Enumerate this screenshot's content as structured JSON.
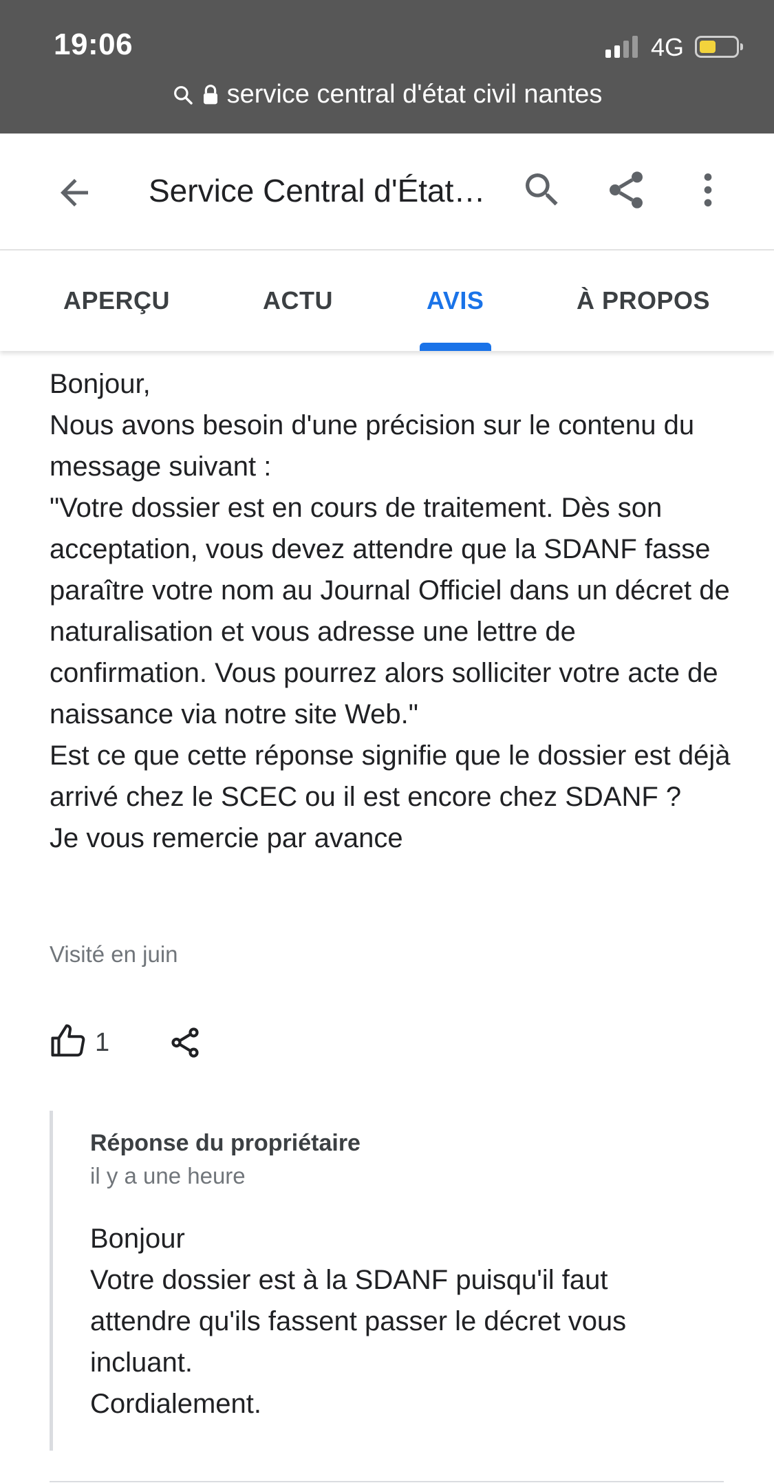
{
  "status_bar": {
    "time": "19:06",
    "network": "4G",
    "battery_level": 0.45,
    "url": "service central d'état civil nantes"
  },
  "app_bar": {
    "title": "Service Central d'État civil"
  },
  "tabs": {
    "items": [
      {
        "label": "APERÇU"
      },
      {
        "label": "ACTU"
      },
      {
        "label": "AVIS"
      },
      {
        "label": "À PROPOS"
      }
    ],
    "active": "AVIS"
  },
  "review": {
    "lines": [
      "Bonjour,",
      "Nous avons besoin d'une précision sur le contenu du message suivant :",
      "\"Votre dossier est en cours de traitement. Dès son acceptation, vous devez attendre que la SDANF fasse paraître votre nom au Journal Officiel dans un décret de naturalisation et vous adresse une lettre de confirmation. Vous pourrez alors solliciter votre acte de naissance via notre site Web.\"",
      "Est ce que cette réponse signifie que le dossier est déjà arrivé chez le SCEC ou il est encore chez SDANF ?",
      "Je vous remercie par avance"
    ],
    "visited": "Visité en juin",
    "like_count": "1"
  },
  "owner_response": {
    "title": "Réponse du propriétaire",
    "time": "il y a une heure",
    "lines": [
      "Bonjour",
      "Votre dossier est à la SDANF puisqu'il faut attendre qu'ils fassent passer le décret vous incluant.",
      "Cordialement."
    ]
  },
  "colors": {
    "status_bar_bg": "#575757",
    "accent": "#1a73e8",
    "battery": "#f2d33c"
  }
}
